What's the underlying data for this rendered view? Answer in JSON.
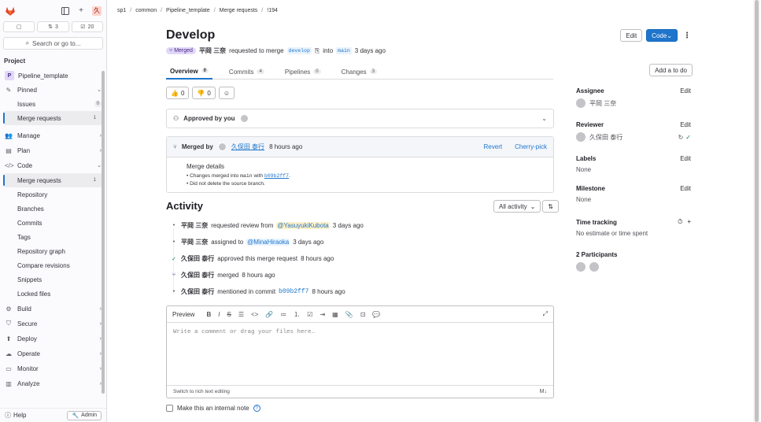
{
  "sidebar": {
    "counts": [
      {
        "label": ""
      },
      {
        "label": "3"
      },
      {
        "label": "20"
      }
    ],
    "search_label": "Search or go to...",
    "section_title": "Project",
    "project_name": "Pipeline_template",
    "project_initial": "P",
    "user_initial": "久",
    "items": {
      "pinned": "Pinned",
      "issues": "Issues",
      "issues_count": "0",
      "pinned_mr": "Merge requests",
      "pinned_mr_count": "1",
      "manage": "Manage",
      "plan": "Plan",
      "code": "Code",
      "code_mr": "Merge requests",
      "code_mr_count": "1",
      "repository": "Repository",
      "branches": "Branches",
      "commits": "Commits",
      "tags": "Tags",
      "repo_graph": "Repository graph",
      "compare": "Compare revisions",
      "snippets": "Snippets",
      "locked": "Locked files",
      "build": "Build",
      "secure": "Secure",
      "deploy": "Deploy",
      "operate": "Operate",
      "monitor": "Monitor",
      "analyze": "Analyze"
    },
    "help": "Help",
    "admin": "Admin"
  },
  "breadcrumb": [
    "sp1",
    "common",
    "Pipeline_template",
    "Merge requests",
    "!194"
  ],
  "mr": {
    "title": "Develop",
    "status": "Merged",
    "author": "平岡 三奈",
    "requested_text": "requested to merge",
    "source_branch": "develop",
    "into_text": "into",
    "target_branch": "main",
    "time": "3 days ago"
  },
  "header_buttons": {
    "edit": "Edit",
    "code": "Code"
  },
  "tabs": [
    {
      "label": "Overview",
      "count": "0"
    },
    {
      "label": "Commits",
      "count": "4"
    },
    {
      "label": "Pipelines",
      "count": "0"
    },
    {
      "label": "Changes",
      "count": "3"
    }
  ],
  "todo_button": "Add a to do",
  "reactions": {
    "thumbs_up": "0",
    "thumbs_down": "0"
  },
  "approval": {
    "label": "Approved by you"
  },
  "merged_widget": {
    "merged_by": "Merged by",
    "user": "久保田 泰行",
    "time": "8 hours ago",
    "revert": "Revert",
    "cherry_pick": "Cherry-pick",
    "details_title": "Merge details",
    "detail_1_pre": "Changes merged into",
    "detail_1_branch": "main",
    "detail_1_mid": "with",
    "detail_1_commit": "b09b2ff7",
    "detail_1_end": ".",
    "detail_2": "Did not delete the source branch."
  },
  "activity": {
    "title": "Activity",
    "filter": "All activity",
    "items": [
      {
        "user": "平岡 三奈",
        "text": "requested review from",
        "mention": "@YasuyukiKubota",
        "time": "3 days ago"
      },
      {
        "user": "平岡 三奈",
        "text": "assigned to",
        "mention": "@MinaHiraoka",
        "time": "3 days ago"
      },
      {
        "user": "久保田 泰行",
        "text": "approved this merge request",
        "time": "8 hours ago"
      },
      {
        "user": "久保田 泰行",
        "text": "merged",
        "time": "8 hours ago"
      },
      {
        "user": "久保田 泰行",
        "text": "mentioned in commit",
        "commit": "b09b2ff7",
        "time": "8 hours ago"
      }
    ]
  },
  "editor": {
    "preview": "Preview",
    "placeholder": "Write a comment or drag your files here…",
    "switch_text": "Switch to rich text editing",
    "internal_note": "Make this an internal note"
  },
  "right_sidebar": {
    "assignee_label": "Assignee",
    "assignee": "平岡 三奈",
    "reviewer_label": "Reviewer",
    "reviewer": "久保田 泰行",
    "labels_label": "Labels",
    "labels_value": "None",
    "milestone_label": "Milestone",
    "milestone_value": "None",
    "time_label": "Time tracking",
    "time_value": "No estimate or time spent",
    "participants_label": "2 Participants",
    "edit": "Edit"
  },
  "colors": {
    "accent": "#1f75cb",
    "merged": "#4c2b86",
    "merged_bg": "#e1d8f9"
  }
}
